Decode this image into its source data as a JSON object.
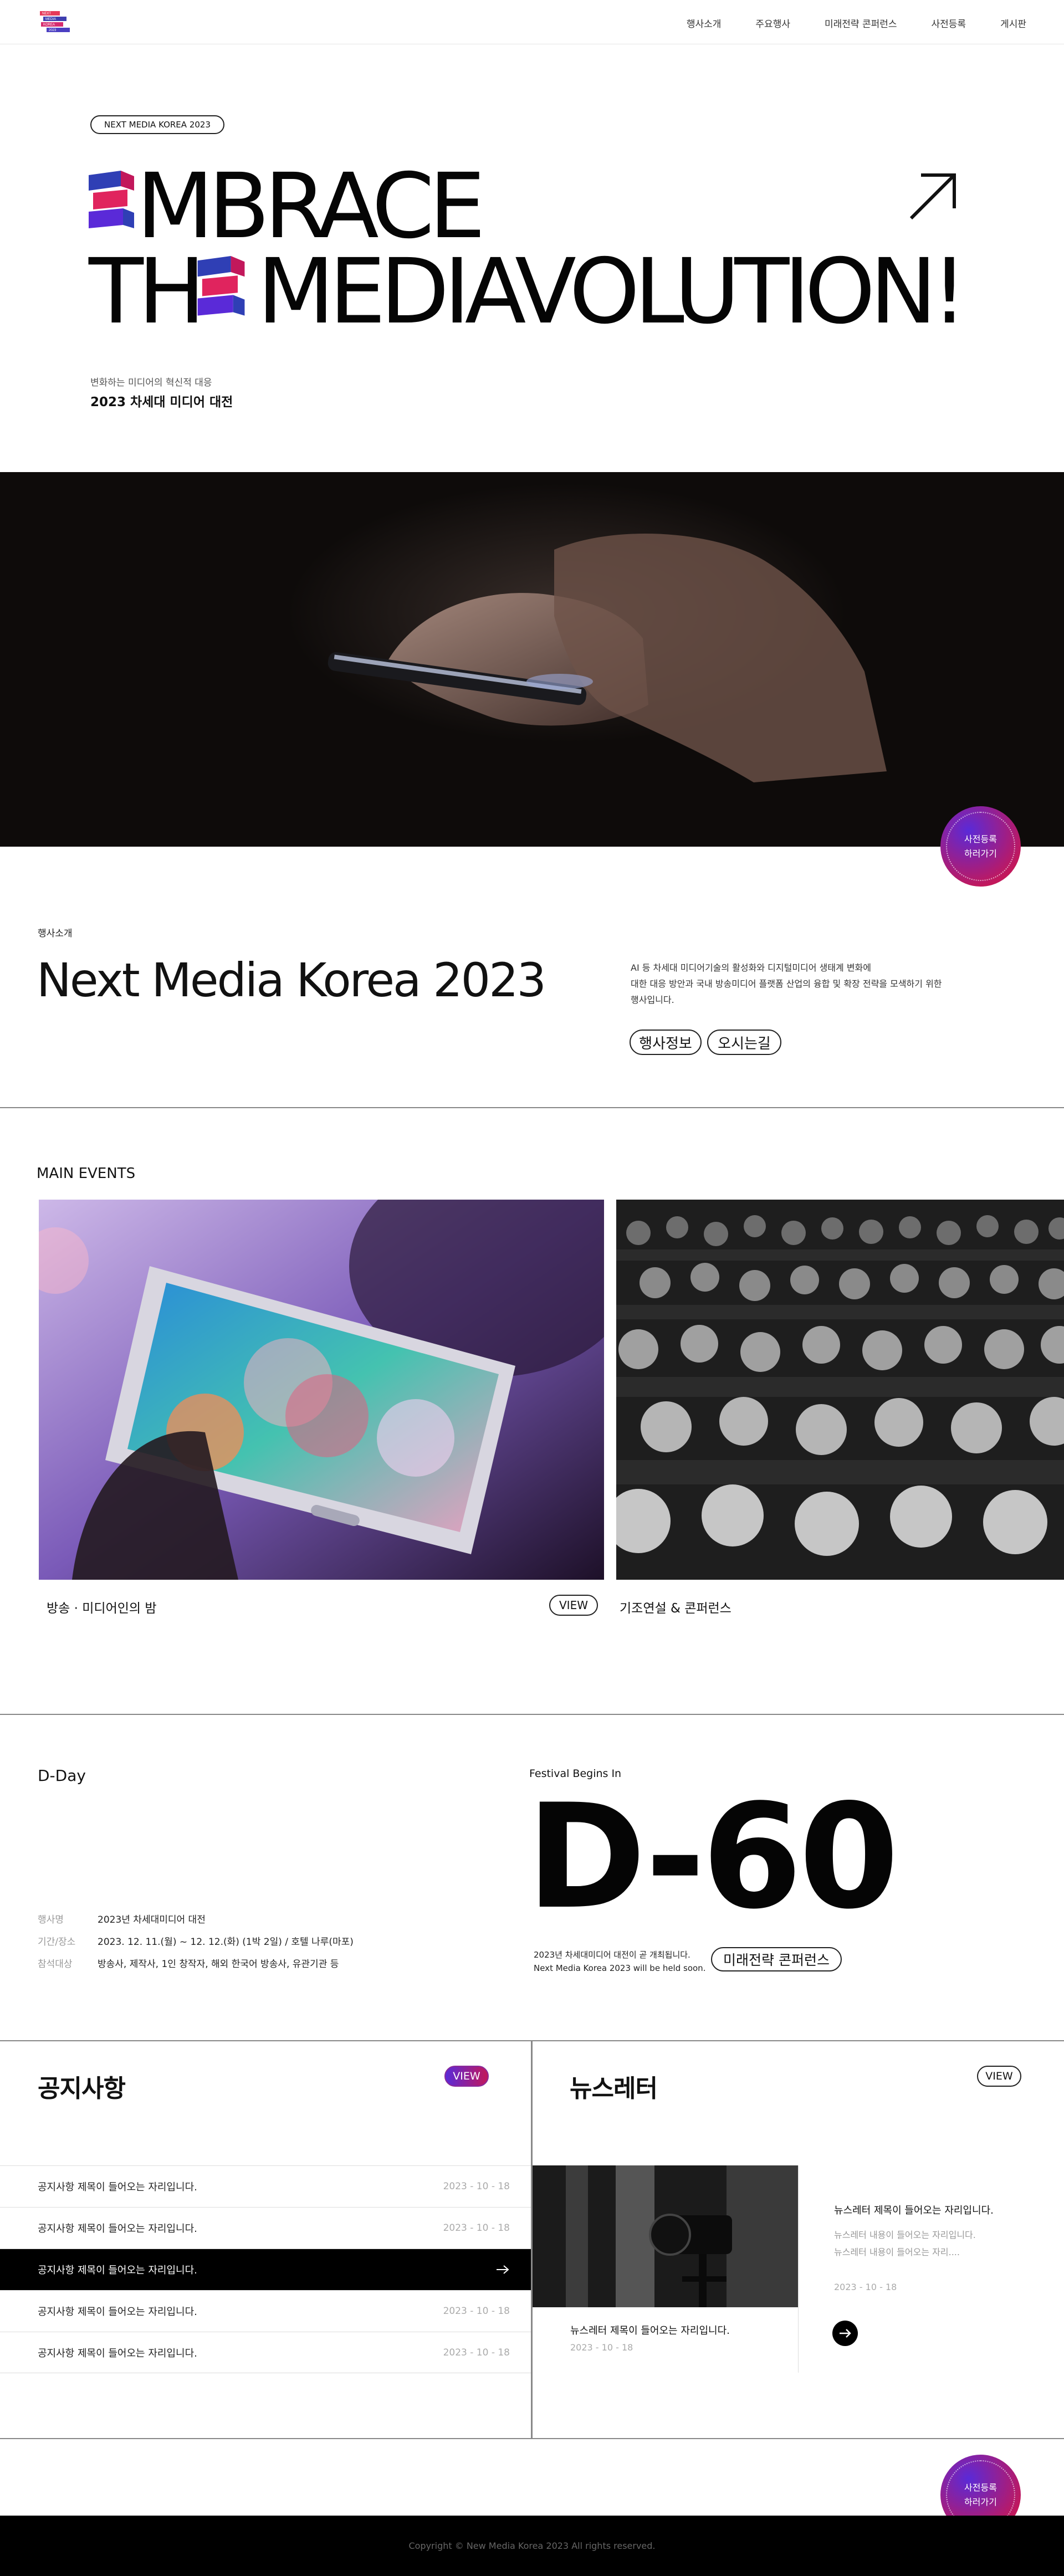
{
  "header": {
    "logo_text": [
      "NEXT",
      "MEDIA",
      "KOREA",
      "2023"
    ],
    "nav": [
      "행사소개",
      "주요행사",
      "미래전략 콘퍼런스",
      "사전등록",
      "게시판"
    ]
  },
  "intro": {
    "eyebrow": "NEXT MEDIA KOREA 2023",
    "headline_line1": "MBRACE",
    "headline_line2_a": "TH",
    "headline_line2_b": "MEDIAVOLUTION!",
    "headline_full": "EMBRACE THE MEDIAVOLUTION!",
    "subtitle_small": "변화하는 미디어의 혁신적 대응",
    "subtitle_bold": "2023 차세대 미디어 대전"
  },
  "fab": {
    "line1": "사전등록",
    "line2": "하러가기"
  },
  "about": {
    "label": "행사소개",
    "title": "Next Media Korea 2023",
    "desc_l1": "AI 등 차세대 미디어기술의 활성화와 디지털미디어 생태계 변화에",
    "desc_l2": "대한 대응 방안과 국내 방송미디어 플랫폼 산업의 융합 및 확장 전략을 모색하기 위한",
    "desc_l3": "행사입니다.",
    "btn_info": "행사정보",
    "btn_map": "오시는길"
  },
  "events": {
    "label": "MAIN EVENTS",
    "cards": [
      {
        "title": "방송 · 미디어인의 밤",
        "view": "VIEW"
      },
      {
        "title": "기조연설 & 콘퍼런스"
      }
    ]
  },
  "dday": {
    "label": "D-Day",
    "festival": "Festival Begins In",
    "count": "D-60",
    "rows": [
      {
        "k": "행사명",
        "v": "2023년 차세대미디어 대전"
      },
      {
        "k": "기간/장소",
        "v": "2023. 12. 11.(월) ~ 12. 12.(화) (1박 2일) / 호텔 나루(마포)"
      },
      {
        "k": "참석대상",
        "v": "방송사, 제작사, 1인 창작자, 해외 한국어 방송사, 유관기관 등"
      }
    ],
    "note_l1": "2023년 차세대미디어 대전이 곧 개최됩니다.",
    "note_l2": "Next Media Korea 2023 will be held soon.",
    "btn": "미래전략 콘퍼런스"
  },
  "notice": {
    "title": "공지사항",
    "view": "VIEW",
    "rows": [
      {
        "title": "공지사항 제목이 들어오는 자리입니다.",
        "date": "2023 - 10 - 18"
      },
      {
        "title": "공지사항 제목이 들어오는 자리입니다.",
        "date": "2023 - 10 - 18"
      },
      {
        "title": "공지사항 제목이 들어오는 자리입니다.",
        "date": ""
      },
      {
        "title": "공지사항 제목이 들어오는 자리입니다.",
        "date": "2023 - 10 - 18"
      },
      {
        "title": "공지사항 제목이 들어오는 자리입니다.",
        "date": "2023 - 10 - 18"
      }
    ]
  },
  "newsletter": {
    "title": "뉴스레터",
    "view": "VIEW",
    "item1_title": "뉴스레터 제목이 들어오는 자리입니다.",
    "item1_date": "2023 - 10 - 18",
    "item2_title": "뉴스레터 제목이 들어오는 자리입니다.",
    "item2_l1": "뉴스레터 내용이 들어오는 자리입니다.",
    "item2_l2": "뉴스레터 내용이 들어오는 자리....",
    "item2_date": "2023 - 10 - 18"
  },
  "footer": {
    "copyright": "Copyright © New Media Korea 2023 All rights reserved."
  },
  "colors": {
    "accent_pink": "#c2185b",
    "accent_purple": "#5a2ad8",
    "logo_blue": "#2f3fb5"
  },
  "icons": [
    "arrow-up-right-icon",
    "arrow-right-icon",
    "logo-cube-icon"
  ]
}
